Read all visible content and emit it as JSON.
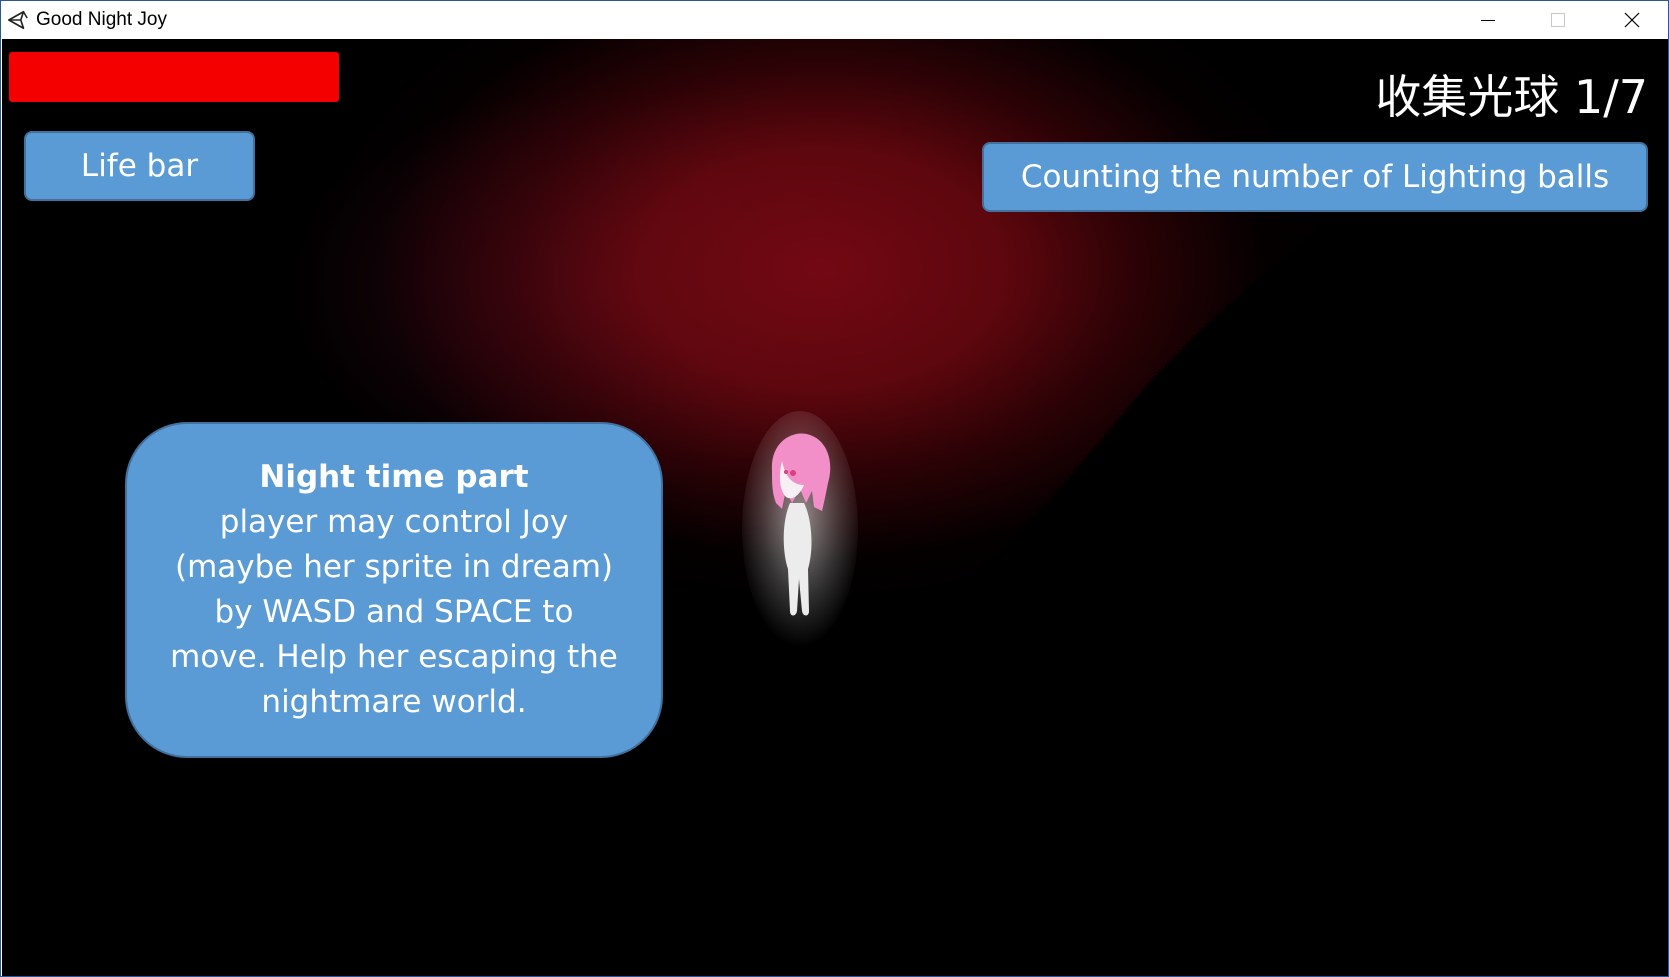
{
  "window": {
    "title": "Good Night Joy",
    "icon": "unity-logo-icon",
    "controls": [
      "minimize-icon",
      "maximize-icon",
      "close-icon"
    ]
  },
  "hud": {
    "life_bar_level": 1.0,
    "life_bar_color": "#f40000",
    "counter_text": "收集光球 1/7"
  },
  "annotations": {
    "life_bar_label": "Life bar",
    "counter_label": "Counting the number of Lighting balls",
    "night_heading": "Night time part",
    "night_lines": [
      "player may control Joy",
      "(maybe her sprite in dream)",
      "by WASD and SPACE to",
      "move. Help her escaping the",
      "nightmare world."
    ]
  },
  "colors": {
    "callout_fill": "#5b9bd5",
    "callout_border": "#41719c",
    "background": "#000000",
    "glow": "#78081a",
    "joy_hair": "#f28fc8"
  }
}
